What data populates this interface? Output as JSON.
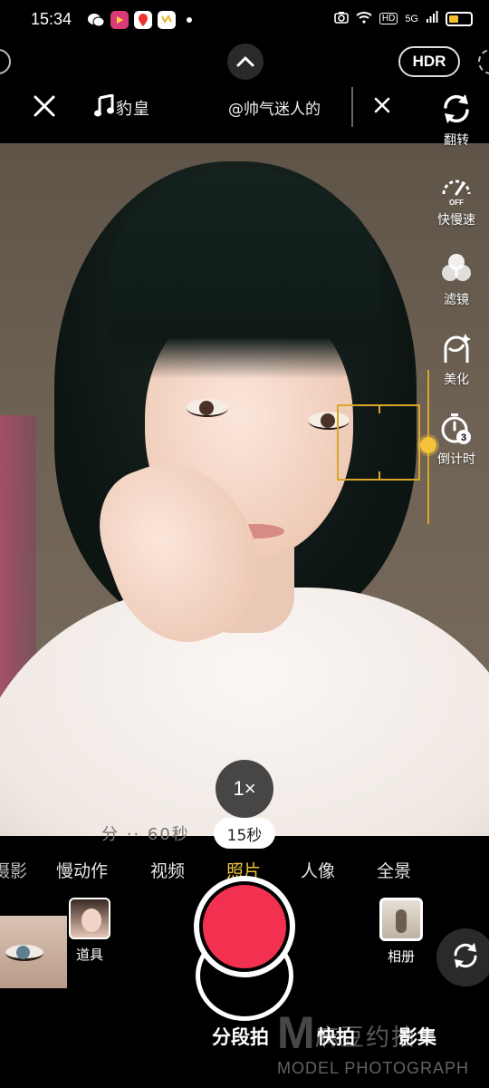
{
  "status_bar": {
    "time": "15:34",
    "network": "5G",
    "hd": "HD"
  },
  "top_controls": {
    "hdr_label": "HDR"
  },
  "music": {
    "title": "豹皇",
    "author": "@帅气迷人的"
  },
  "toolbar": {
    "items": [
      {
        "label": "翻转",
        "icon": "flip-icon"
      },
      {
        "label": "快慢速",
        "icon": "speed-icon",
        "sub": "OFF"
      },
      {
        "label": "滤镜",
        "icon": "filter-icon"
      },
      {
        "label": "美化",
        "icon": "beauty-icon"
      },
      {
        "label": "倒计时",
        "icon": "timer-icon",
        "sub": "3"
      }
    ]
  },
  "zoom": {
    "label": "1×"
  },
  "duration": {
    "label": "15秒",
    "ghost": "分 ·· 60秒"
  },
  "mode_tabs": {
    "items": [
      "摄影",
      "慢动作",
      "视频",
      "照片",
      "人像",
      "全景"
    ],
    "active": "照片"
  },
  "bottom": {
    "props_label": "道具",
    "album_label": "相册"
  },
  "capture_modes": {
    "items": [
      "分段拍",
      "快拍",
      "影集"
    ]
  },
  "watermark": {
    "logo": "M",
    "cn": "麻豆约拍",
    "en": "MODEL PHOTOGRAPH"
  },
  "colors": {
    "accent": "#f2c23a",
    "shutter": "#f23150",
    "focus": "#d9a62a"
  }
}
